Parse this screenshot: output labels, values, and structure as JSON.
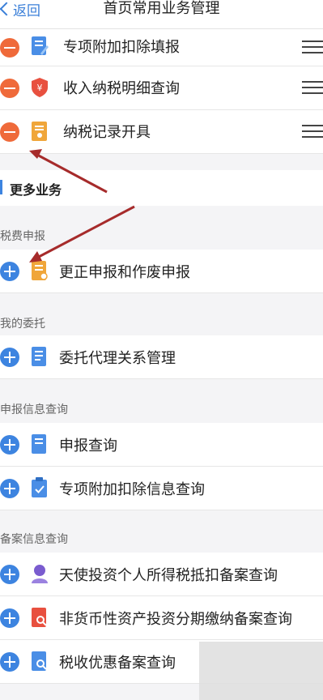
{
  "nav": {
    "back_label": "返回",
    "title": "首页常用业务管理"
  },
  "common_items": [
    {
      "label": "专项附加扣除填报",
      "icon": "form-icon"
    },
    {
      "label": "收入纳税明细查询",
      "icon": "yen-shield-icon"
    },
    {
      "label": "纳税记录开具",
      "icon": "certificate-icon"
    }
  ],
  "more_section": {
    "title": "更多业务"
  },
  "groups": [
    {
      "title": "税费申报",
      "items": [
        {
          "label": "更正申报和作废申报",
          "icon": "correction-doc-icon"
        }
      ]
    },
    {
      "title": "我的委托",
      "items": [
        {
          "label": "委托代理关系管理",
          "icon": "list-doc-icon"
        }
      ]
    },
    {
      "title": "申报信息查询",
      "items": [
        {
          "label": "申报查询",
          "icon": "doc-icon"
        },
        {
          "label": "专项附加扣除信息查询",
          "icon": "clipboard-icon"
        }
      ]
    },
    {
      "title": "备案信息查询",
      "items": [
        {
          "label": "天使投资个人所得税抵扣备案查询",
          "icon": "person-icon"
        },
        {
          "label": "非货币性资产投资分期缴纳备案查询",
          "icon": "search-doc-icon"
        },
        {
          "label": "税收优惠备案查询",
          "icon": "search-doc-icon"
        }
      ]
    }
  ],
  "colors": {
    "accent_blue": "#3d84e0",
    "remove_orange": "#ef6a3a",
    "arrow_red": "#a62b2b"
  }
}
